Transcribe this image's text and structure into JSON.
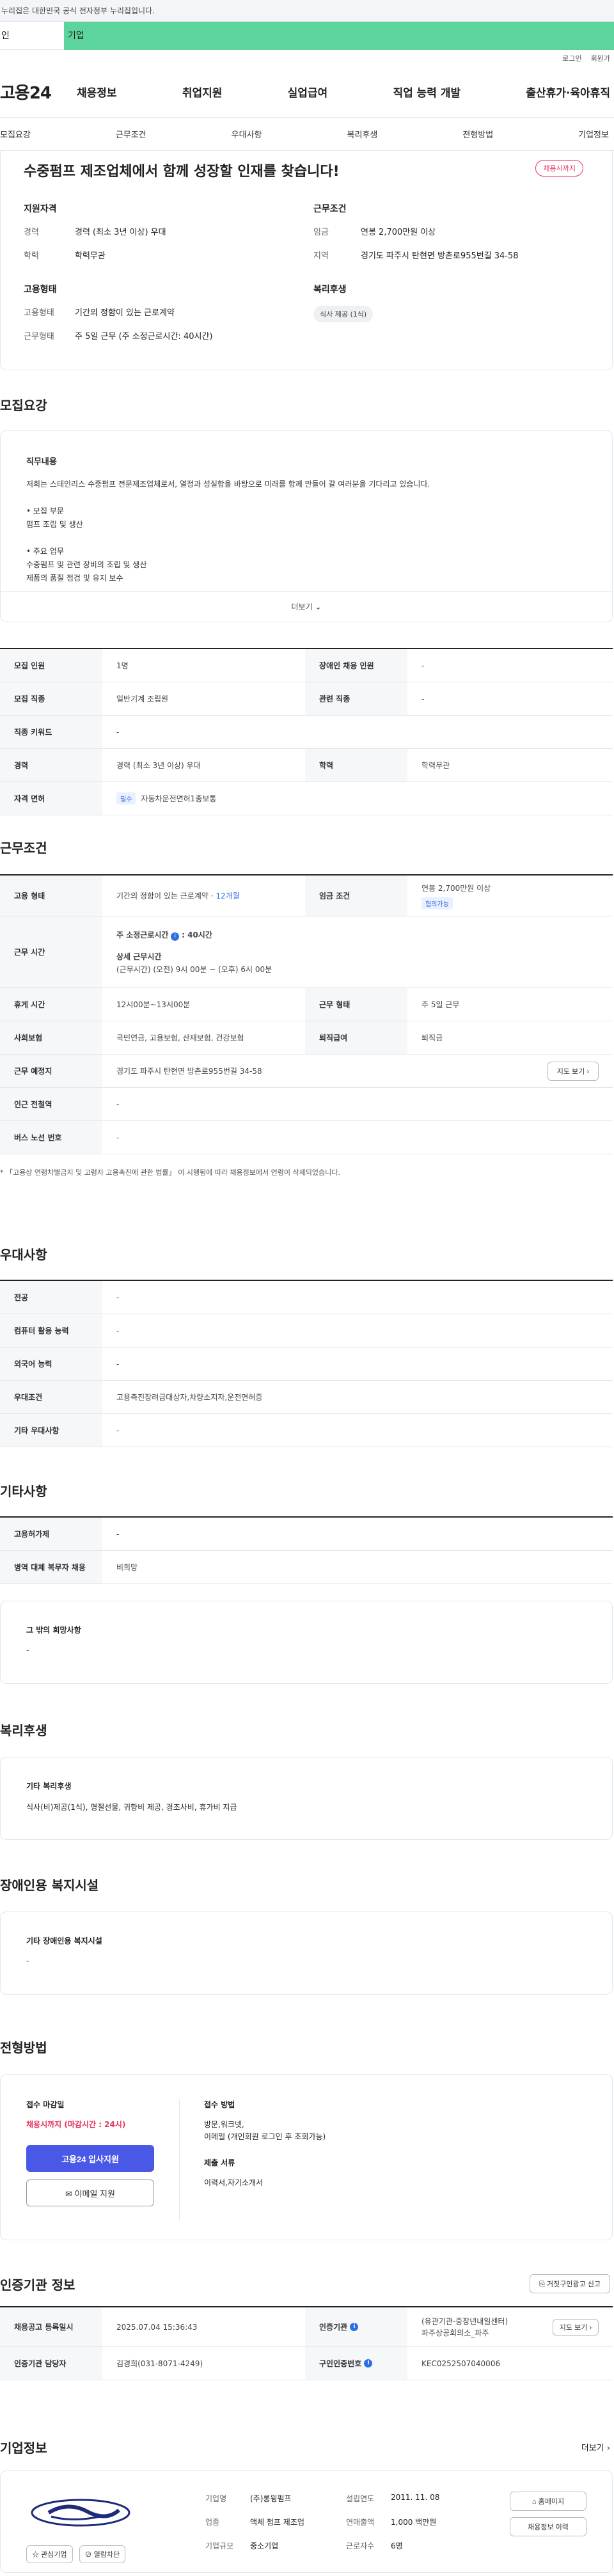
{
  "gov_notice": "누리집은 대한민국 공식 전자정부 누리집입니다.",
  "tabs": {
    "personal": "인",
    "company": "기업"
  },
  "util": {
    "login": "로그인",
    "join": "회원가"
  },
  "logo": "고용24",
  "gnb": [
    "채용정보",
    "취업지원",
    "실업급여",
    "직업 능력 개발",
    "출산휴가·육아휴직"
  ],
  "anchors": [
    "모집요강",
    "근무조건",
    "우대사항",
    "복리후생",
    "전형방법",
    "기업정보"
  ],
  "summary": {
    "title": "수중펌프 제조업체에서 함께 성장할 인재를 찾습니다!",
    "badge": "채용시까지",
    "qual_title": "지원자격",
    "cond_title": "근무조건",
    "emp_title": "고용형태",
    "welfare_title": "복리후생",
    "career_k": "경력",
    "career_v": "경력 (최소 3년 이상) 우대",
    "edu_k": "학력",
    "edu_v": "학력무관",
    "pay_k": "임금",
    "pay_v": "연봉 2,700만원 이상",
    "region_k": "지역",
    "region_v": "경기도 파주시 탄현면 방촌로955번길 34-58",
    "type_k": "고용형태",
    "type_v": "기간의 정함이 있는 근로계약",
    "work_k": "근무형태",
    "work_v": "주 5일 근무 (주 소정근로시간: 40시간)",
    "welfare_chip": "식사 제공 (1식)"
  },
  "recruit": {
    "title": "모집요강",
    "job_title": "직무내용",
    "lines": [
      "저희는 스테인리스 수중펌프 전문제조업체로서, 열정과 성실함을 바탕으로 미래를 함께 만들어 갈 여러분을 기다리고 있습니다.",
      "",
      "• 모집 부문",
      "펌프 조립 및 생산",
      "",
      "• 주요 업무",
      "수중펌프 및 관련 장비의 조립 및 생산",
      "제품의 품질 점검 및 유지 보수"
    ],
    "more": "더보기",
    "r1": [
      [
        "모집 인원",
        "1명"
      ],
      [
        "장애인 채용 인원",
        "-"
      ]
    ],
    "r2": [
      [
        "모집 직종",
        "일반기계 조립원"
      ],
      [
        "관련 직종",
        "-"
      ]
    ],
    "r3": [
      "직종 키워드",
      "-"
    ],
    "r4": [
      [
        "경력",
        "경력 (최소 3년 이상) 우대"
      ],
      [
        "학력",
        "학력무관"
      ]
    ],
    "r5": [
      "자격 면허",
      "필수",
      "자동차운전면허1종보통"
    ]
  },
  "cond": {
    "title": "근무조건",
    "emp_k": "고용 형태",
    "emp_v": "기간의 정함이 있는 근로계약 · ",
    "emp_months": "12개월",
    "pay_k": "임금 조건",
    "pay_v": "연봉 2,700만원 이상",
    "pay_badge": "협의가능",
    "time_k": "근무 시간",
    "time_main": "주 소정근로시간",
    "time_main_v": ": 40시간",
    "time_detail_t": "상세 근무시간",
    "time_detail_v": "(근무시간) (오전) 9시 00분 ~ (오후) 6시 00분",
    "rest_k": "휴게 시간",
    "rest_v": "12시00분~13시00분",
    "form_k": "근무 형태",
    "form_v": "주 5일 근무",
    "ins_k": "사회보험",
    "ins_v": "국민연금, 고용보험, 산재보험, 건강보험",
    "ret_k": "퇴직급여",
    "ret_v": "퇴직금",
    "place_k": "근무 예정지",
    "place_v": "경기도 파주시 탄현면 방촌로955번길 34-58",
    "map_btn": "지도 보기",
    "sub_k": "인근 전철역",
    "sub_v": "-",
    "bus_k": "버스 노선 번호",
    "bus_v": "-",
    "note": "* 「고용상 연령차별금지 및 고령자 고용촉진에 관한 법률」 이 시행됨에 따라 채용정보에서 연령이 삭제되었습니다."
  },
  "pref": {
    "title": "우대사항",
    "rows": [
      [
        "전공",
        "-"
      ],
      [
        "컴퓨터 활용 능력",
        "-"
      ],
      [
        "외국어 능력",
        "-"
      ],
      [
        "우대조건",
        "고용촉진장려금대상자,차량소지자,운전면허증"
      ],
      [
        "기타 우대사항",
        "-"
      ]
    ]
  },
  "etc": {
    "title": "기타사항",
    "rows": [
      [
        "고용허가제",
        "-"
      ],
      [
        "병역 대체 복무자 채용",
        "비희망"
      ]
    ],
    "hope_t": "그 밖의 희망사항",
    "hope_v": "-"
  },
  "welfare": {
    "title": "복리후생",
    "t": "기타 복리후생",
    "v": "식사(비)제공(1식), 명절선물, 귀향비 제공, 경조사비, 휴가비 지급"
  },
  "disab": {
    "title": "장애인용 복지시설",
    "t": "기타 장애인용 복지시설",
    "v": "-"
  },
  "method": {
    "title": "전형방법",
    "deadline_t": "접수 마감일",
    "deadline_v": "채용시까지 (마감시간 : 24시)",
    "apply_btn": "고용24 입사지원",
    "email_btn": "이메일 지원",
    "recv_t": "접수 방법",
    "recv_v1": "방문,워크넷,",
    "recv_v2": "이메일 (개인회원 로그인 후 조회가능)",
    "docs_t": "제출 서류",
    "docs_v": "이력서,자기소개서"
  },
  "cert": {
    "title": "인증기관 정보",
    "report_btn": "거짓구인광고 신고",
    "reg_k": "채용공고 등록일시",
    "reg_v": "2025.07.04 15:36:43",
    "org_k": "인증기관",
    "org_v1": "(유관기관-중장년내일센터)",
    "org_v2": "파주상공회의소_파주",
    "map_btn": "지도 보기",
    "mgr_k": "인증기관 담당자",
    "mgr_v": "김경희(031-8071-4249)",
    "num_k": "구인인증번호",
    "num_v": "KEC0252507040006"
  },
  "company": {
    "title": "기업정보",
    "more": "더보기",
    "name_k": "기업명",
    "name_v": "(주)롱윙펌프",
    "year_k": "설립연도",
    "year_v": "2011. 11. 08",
    "ind_k": "업종",
    "ind_v": "액체 펌프 제조업",
    "rev_k": "연매출액",
    "rev_v": "1,000 백만원",
    "scale_k": "기업규모",
    "scale_v": "중소기업",
    "emp_k": "근로자수",
    "emp_v": "6명",
    "home_btn": "홈페이지",
    "jobs_btn": "채용정보 이력",
    "fav_btn": "관심기업",
    "block_btn": "열람차단"
  }
}
